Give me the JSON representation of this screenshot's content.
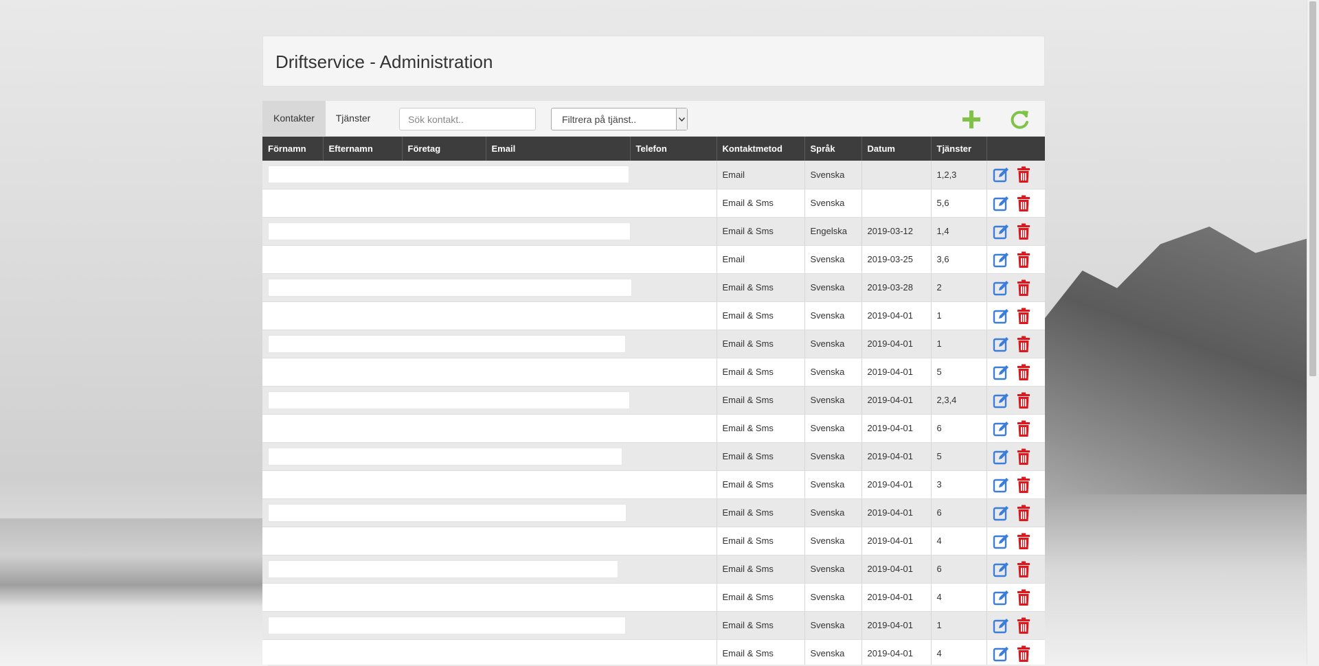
{
  "page": {
    "title": "Driftservice - Administration"
  },
  "toolbar": {
    "tabs": [
      {
        "label": "Kontakter",
        "active": true
      },
      {
        "label": "Tjänster",
        "active": false
      }
    ],
    "search_placeholder": "Sök kontakt..",
    "filter_selected": "Filtrera på tjänst..",
    "add_icon": "plus-icon",
    "refresh_icon": "refresh-icon",
    "accent_color": "#7ec247"
  },
  "table": {
    "columns": [
      "Förnamn",
      "Efternamn",
      "Företag",
      "Email",
      "Telefon",
      "Kontaktmetod",
      "Språk",
      "Datum",
      "Tjänster",
      ""
    ],
    "rows": [
      {
        "kontaktmetod": "Email",
        "sprak": "Svenska",
        "datum": "",
        "tjanster": "1,2,3"
      },
      {
        "kontaktmetod": "Email & Sms",
        "sprak": "Svenska",
        "datum": "",
        "tjanster": "5,6"
      },
      {
        "kontaktmetod": "Email & Sms",
        "sprak": "Engelska",
        "datum": "2019-03-12",
        "tjanster": "1,4"
      },
      {
        "kontaktmetod": "Email",
        "sprak": "Svenska",
        "datum": "2019-03-25",
        "tjanster": "3,6"
      },
      {
        "kontaktmetod": "Email & Sms",
        "sprak": "Svenska",
        "datum": "2019-03-28",
        "tjanster": "2"
      },
      {
        "kontaktmetod": "Email & Sms",
        "sprak": "Svenska",
        "datum": "2019-04-01",
        "tjanster": "1"
      },
      {
        "kontaktmetod": "Email & Sms",
        "sprak": "Svenska",
        "datum": "2019-04-01",
        "tjanster": "1"
      },
      {
        "kontaktmetod": "Email & Sms",
        "sprak": "Svenska",
        "datum": "2019-04-01",
        "tjanster": "5"
      },
      {
        "kontaktmetod": "Email & Sms",
        "sprak": "Svenska",
        "datum": "2019-04-01",
        "tjanster": "2,3,4"
      },
      {
        "kontaktmetod": "Email & Sms",
        "sprak": "Svenska",
        "datum": "2019-04-01",
        "tjanster": "6"
      },
      {
        "kontaktmetod": "Email & Sms",
        "sprak": "Svenska",
        "datum": "2019-04-01",
        "tjanster": "5"
      },
      {
        "kontaktmetod": "Email & Sms",
        "sprak": "Svenska",
        "datum": "2019-04-01",
        "tjanster": "3"
      },
      {
        "kontaktmetod": "Email & Sms",
        "sprak": "Svenska",
        "datum": "2019-04-01",
        "tjanster": "6"
      },
      {
        "kontaktmetod": "Email & Sms",
        "sprak": "Svenska",
        "datum": "2019-04-01",
        "tjanster": "4"
      },
      {
        "kontaktmetod": "Email & Sms",
        "sprak": "Svenska",
        "datum": "2019-04-01",
        "tjanster": "6"
      },
      {
        "kontaktmetod": "Email & Sms",
        "sprak": "Svenska",
        "datum": "2019-04-01",
        "tjanster": "4"
      },
      {
        "kontaktmetod": "Email & Sms",
        "sprak": "Svenska",
        "datum": "2019-04-01",
        "tjanster": "1"
      },
      {
        "kontaktmetod": "Email & Sms",
        "sprak": "Svenska",
        "datum": "2019-04-01",
        "tjanster": "4"
      }
    ],
    "row_actions": {
      "edit_icon": "edit-icon",
      "delete_icon": "trash-icon",
      "edit_color": "#3b7dd8",
      "delete_color": "#e0161d"
    }
  }
}
